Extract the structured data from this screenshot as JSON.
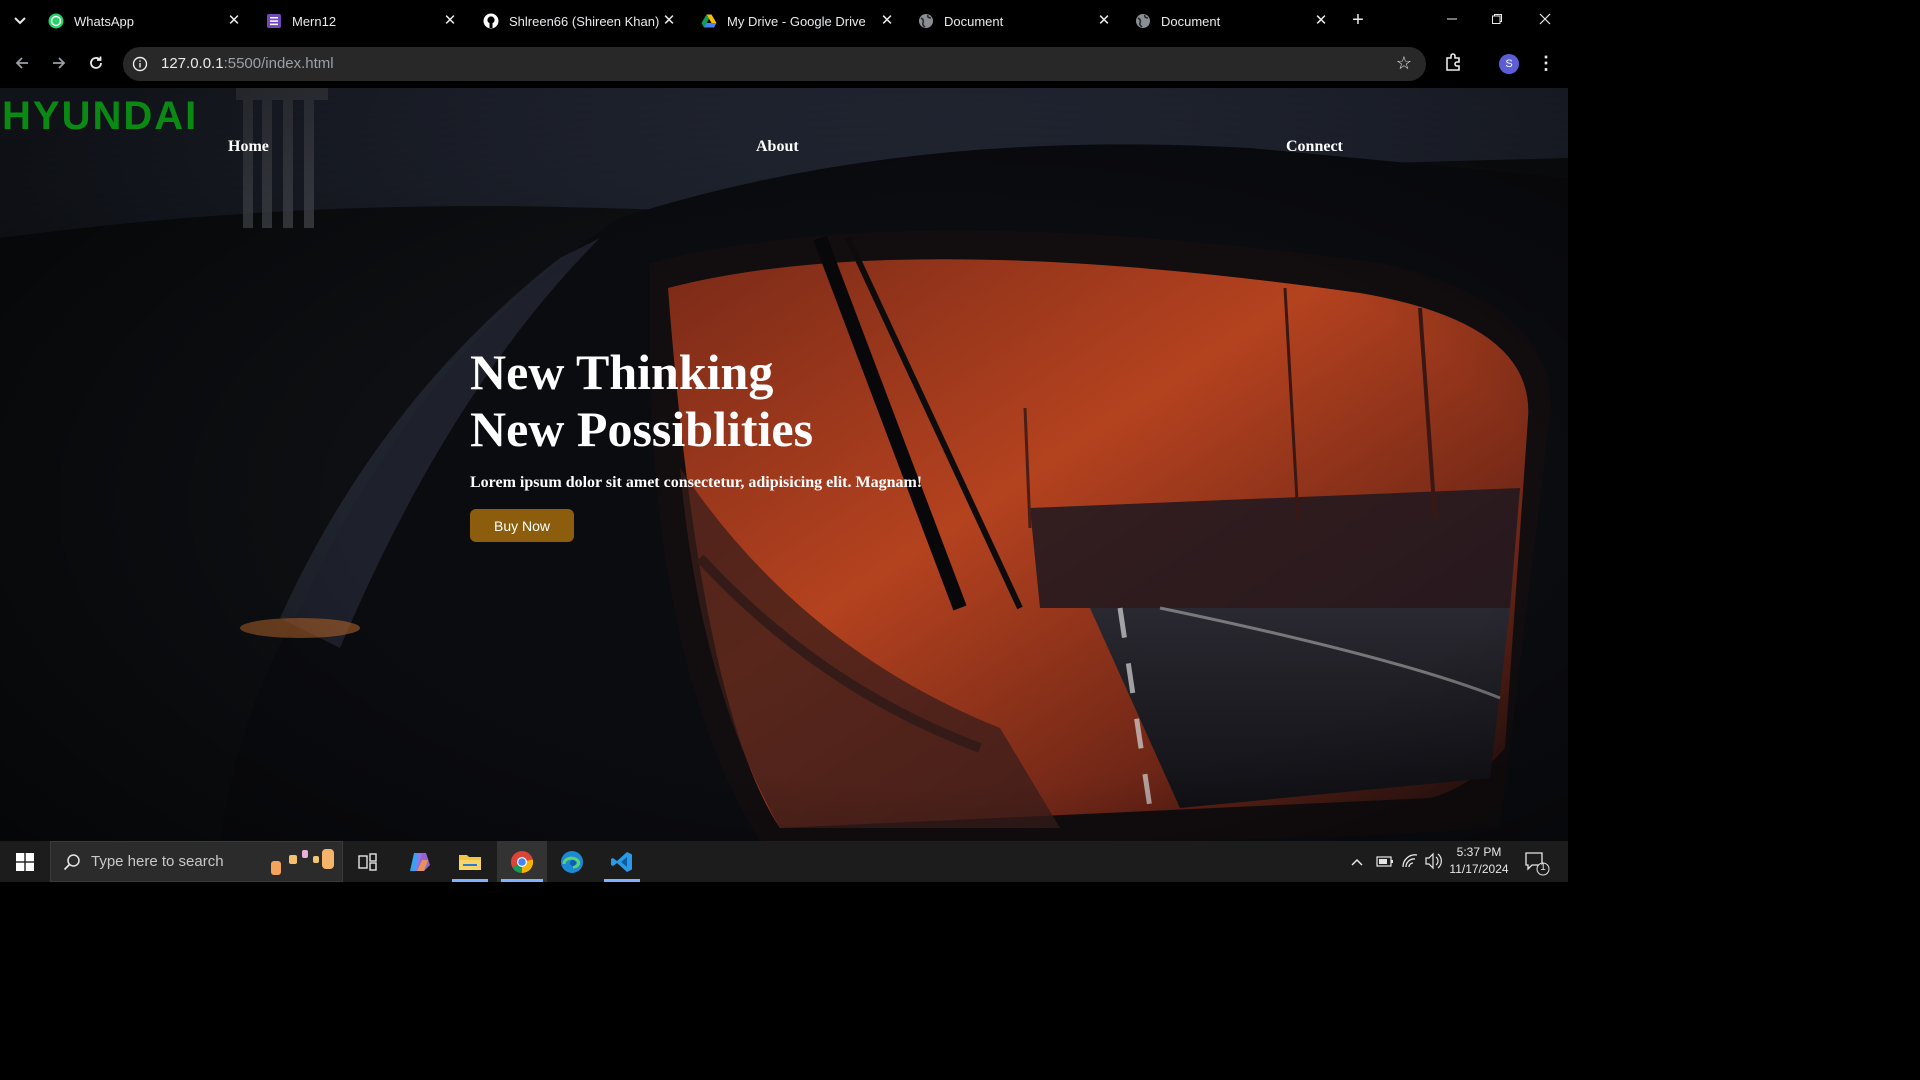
{
  "browser": {
    "tabs": [
      {
        "title": "WhatsApp",
        "icon": "whatsapp-icon"
      },
      {
        "title": "Mern12",
        "icon": "forms-icon"
      },
      {
        "title": "Shlreen66 (Shireen Khan)",
        "icon": "github-icon"
      },
      {
        "title": "My Drive - Google Drive",
        "icon": "google-drive-icon"
      },
      {
        "title": "Document",
        "icon": "globe-icon"
      },
      {
        "title": "Document",
        "icon": "globe-icon"
      }
    ],
    "address": {
      "host": "127.0.0.1",
      "path": ":5500/index.html"
    },
    "profile_initial": "S"
  },
  "site": {
    "brand": "HYUNDAI",
    "nav": [
      "Home",
      "About",
      "Connect"
    ],
    "hero": {
      "title_line1": "New Thinking",
      "title_line2": "New Possiblities",
      "subtitle": "Lorem ipsum dolor sit amet consectetur, adipisicing elit. Magnam!",
      "cta": "Buy Now"
    }
  },
  "taskbar": {
    "search_placeholder": "Type here to search",
    "time": "5:37 PM",
    "date": "11/17/2024",
    "notification_count": "1",
    "apps": [
      "task-view-icon",
      "copilot-icon",
      "file-explorer-icon",
      "chrome-icon",
      "edge-icon",
      "vscode-icon"
    ]
  },
  "colors": {
    "brand": "#0a8a12",
    "cta": "#8b5d0d",
    "chrome_bg": "#000000",
    "omnibox": "#282828"
  }
}
